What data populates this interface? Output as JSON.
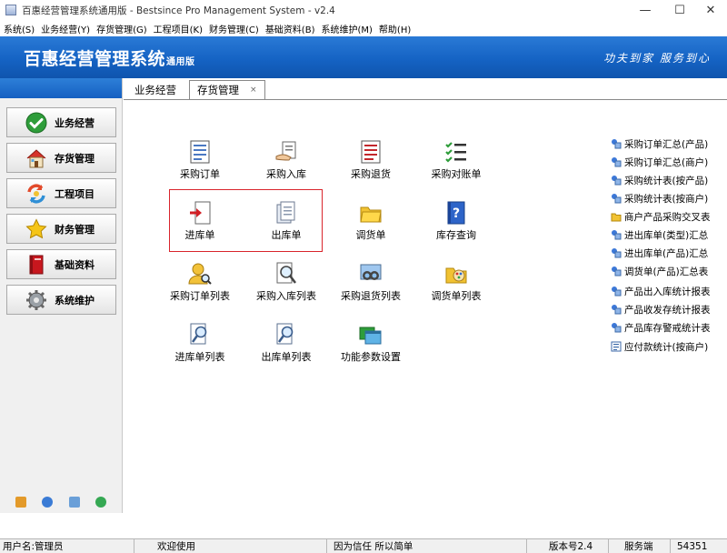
{
  "window": {
    "title": "百惠经营管理系统通用版 - Bestsince Pro Management System - v2.4",
    "minimize": "—",
    "maximize": "☐",
    "close": "✕"
  },
  "menu": [
    "系统(S)",
    "业务经营(Y)",
    "存货管理(G)",
    "工程项目(K)",
    "财务管理(C)",
    "基础资料(B)",
    "系统维护(M)",
    "帮助(H)"
  ],
  "banner": {
    "title": "百惠经营管理系统",
    "subtitle": "通用版",
    "slogan": "功夫到家 服务到心"
  },
  "nav": {
    "items": [
      {
        "label": "业务经营",
        "icon": "check-circle-icon"
      },
      {
        "label": "存货管理",
        "icon": "house-icon"
      },
      {
        "label": "工程项目",
        "icon": "cycle-arrows-icon"
      },
      {
        "label": "财务管理",
        "icon": "star-icon"
      },
      {
        "label": "基础资料",
        "icon": "book-icon"
      },
      {
        "label": "系统维护",
        "icon": "gear-icon"
      }
    ],
    "bottom_icons": [
      "key-icon",
      "clock-icon",
      "search-icon",
      "refresh-icon"
    ]
  },
  "tabs": [
    {
      "label": "业务经营",
      "active": false
    },
    {
      "label": "存货管理",
      "active": true
    }
  ],
  "tab_close": "×",
  "functions": [
    {
      "label": "采购订单",
      "icon": "document-list-icon"
    },
    {
      "label": "采购入库",
      "icon": "hand-document-icon"
    },
    {
      "label": "采购退货",
      "icon": "red-document-icon"
    },
    {
      "label": "采购对账单",
      "icon": "checklist-icon"
    },
    {
      "label": "进库单",
      "icon": "stock-in-icon"
    },
    {
      "label": "出库单",
      "icon": "stock-out-icon"
    },
    {
      "label": "调货单",
      "icon": "folder-icon"
    },
    {
      "label": "库存查询",
      "icon": "help-book-icon"
    },
    {
      "label": "采购订单列表",
      "icon": "user-search-icon"
    },
    {
      "label": "采购入库列表",
      "icon": "magnify-document-icon"
    },
    {
      "label": "采购退货列表",
      "icon": "binoculars-icon"
    },
    {
      "label": "调货单列表",
      "icon": "palette-icon"
    },
    {
      "label": "进库单列表",
      "icon": "search-document-icon"
    },
    {
      "label": "出库单列表",
      "icon": "search-document-icon"
    },
    {
      "label": "功能参数设置",
      "icon": "windows-icon"
    }
  ],
  "reports": [
    {
      "label": "采购订单汇总(产品)",
      "icon": "report-icon"
    },
    {
      "label": "采购订单汇总(商户)",
      "icon": "report-icon"
    },
    {
      "label": "采购统计表(按产品)",
      "icon": "report-icon"
    },
    {
      "label": "采购统计表(按商户)",
      "icon": "report-icon"
    },
    {
      "label": "商户产品采购交叉表",
      "icon": "folder-icon"
    },
    {
      "label": "进出库单(类型)汇总",
      "icon": "report-icon"
    },
    {
      "label": "进出库单(产品)汇总",
      "icon": "report-icon"
    },
    {
      "label": "调货单(产品)汇总表",
      "icon": "report-icon"
    },
    {
      "label": "产品出入库统计报表",
      "icon": "report-icon"
    },
    {
      "label": "产品收发存统计报表",
      "icon": "report-icon"
    },
    {
      "label": "产品库存警戒统计表",
      "icon": "report-icon"
    },
    {
      "label": "应付款统计(按商户)",
      "icon": "list-icon"
    }
  ],
  "status": {
    "user": "用户名:管理员",
    "welcome": "欢迎使用",
    "motto": "因为信任 所以简单",
    "version": "版本号2.4",
    "service": "服务端",
    "number": "54351"
  },
  "colors": {
    "banner": "#1563c4",
    "highlight": "#d9242b"
  }
}
